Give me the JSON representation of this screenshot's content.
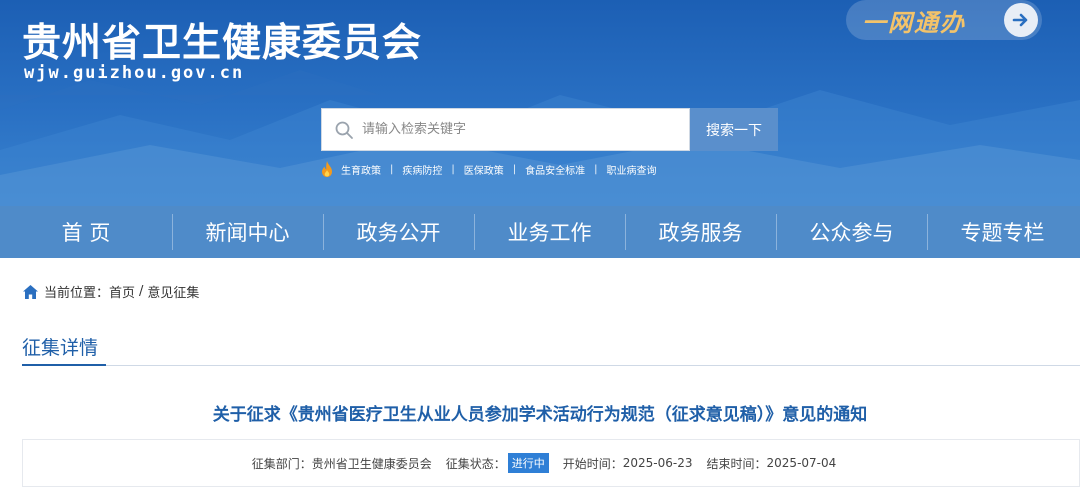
{
  "header": {
    "site_title": "贵州省卫生健康委员会",
    "site_domain": "wjw.guizhou.gov.cn",
    "one_stop_label": "一网通办"
  },
  "search": {
    "placeholder": "请输入检索关键字",
    "button_label": "搜索一下"
  },
  "hotwords": [
    "生育政策",
    "疾病防控",
    "医保政策",
    "食品安全标准",
    "职业病查询"
  ],
  "hotword_separator": "|",
  "nav": [
    "首 页",
    "新闻中心",
    "政务公开",
    "业务工作",
    "政务服务",
    "公众参与",
    "专题专栏"
  ],
  "breadcrumb": {
    "prefix": "当前位置：",
    "home": "首页",
    "separator": "/",
    "current": "意见征集"
  },
  "section": {
    "title": "征集详情"
  },
  "article": {
    "title": "关于征求《贵州省医疗卫生从业人员参加学术活动行为规范（征求意见稿）》意见的通知"
  },
  "meta": {
    "department_label": "征集部门：",
    "department_value": "贵州省卫生健康委员会",
    "status_label": "征集状态：",
    "status_value": "进行中",
    "start_label": "开始时间：",
    "start_value": "2025-06-23",
    "end_label": "结束时间：",
    "end_value": "2025-07-04"
  },
  "colors": {
    "header_blue": "#1c5fb4",
    "nav_blue": "#4f8bc9",
    "title_blue": "#1f5fa8",
    "accent_gold": "#f3c36a",
    "status_blue": "#2f7fd6"
  },
  "icons": {
    "one_stop_arrow": "arrow-right-icon",
    "search": "search-icon",
    "hotwords": "flame-icon",
    "breadcrumb": "home-icon"
  }
}
